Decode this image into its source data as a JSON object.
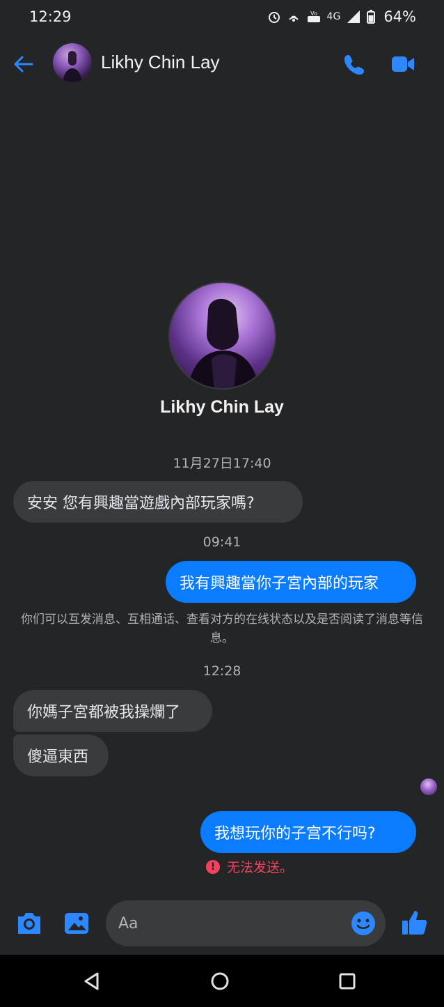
{
  "status_bar": {
    "time": "12:29",
    "network": "4G",
    "battery": "64%"
  },
  "header": {
    "contact_name": "Likhy Chin Lay"
  },
  "profile": {
    "name": "Likhy Chin Lay"
  },
  "conversation": {
    "timestamp_1": "11月27日17:40",
    "msg_in_1": "安安 您有興趣當遊戲內部玩家嗎?",
    "timestamp_2": "09:41",
    "msg_out_1": "我有興趣當你子宮內部的玩家",
    "notice": "你们可以互发消息、互相通话、查看对方的在线状态以及是否阅读了消息等信息。",
    "timestamp_3": "12:28",
    "msg_in_2": "你媽子宮都被我操爛了",
    "msg_in_3": "傻逼東西",
    "msg_out_2": "我想玩你的子宫不行吗?",
    "send_error": "无法发送。"
  },
  "composer": {
    "placeholder": "Aa"
  },
  "colors": {
    "background": "#242526",
    "incoming_bubble": "#3a3b3c",
    "outgoing_bubble": "#0a7cff",
    "accent": "#2d88ff",
    "error": "#f3425f"
  },
  "icons": [
    "back-arrow-icon",
    "phone-icon",
    "video-camera-icon",
    "camera-icon",
    "gallery-icon",
    "emoji-icon",
    "thumbs-up-icon"
  ]
}
